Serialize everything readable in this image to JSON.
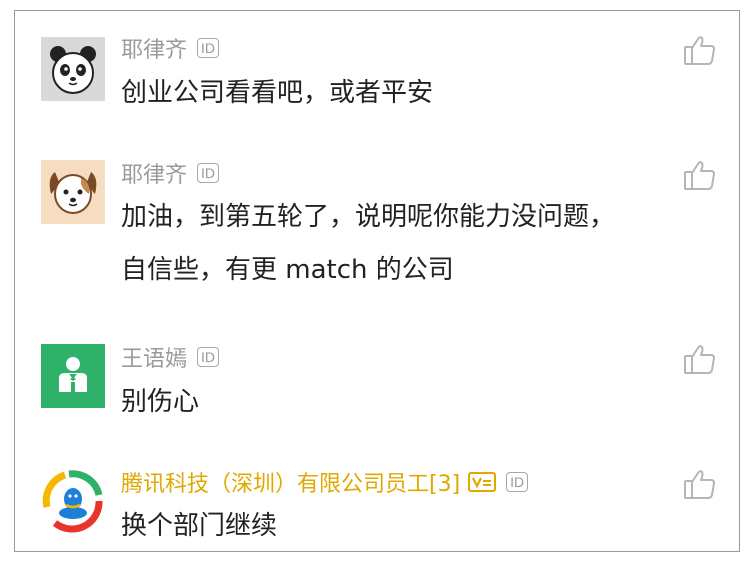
{
  "comments": [
    {
      "name": "耶律齐",
      "id_badge": "ID",
      "lines": [
        "创业公司看看吧，或者平安"
      ]
    },
    {
      "name": "耶律齐",
      "id_badge": "ID",
      "lines": [
        "加油，到第五轮了，说明呢你能力没问题，",
        "自信些，有更 match 的公司"
      ]
    },
    {
      "name": "王语嫣",
      "id_badge": "ID",
      "lines": [
        "别伤心"
      ]
    },
    {
      "name": "腾讯科技（深圳）有限公司员工[3]",
      "id_badge": "ID",
      "lines": [
        "换个部门继续"
      ]
    }
  ],
  "avatars": [
    "panda-avatar",
    "dog-avatar",
    "person-avatar",
    "tencent-logo-avatar"
  ],
  "icons": {
    "like": "thumbs-up-icon",
    "verified": "verified-badge-icon"
  },
  "colors": {
    "name_gray": "#9a9a9a",
    "gold": "#e0a800",
    "green": "#2fb16a"
  }
}
